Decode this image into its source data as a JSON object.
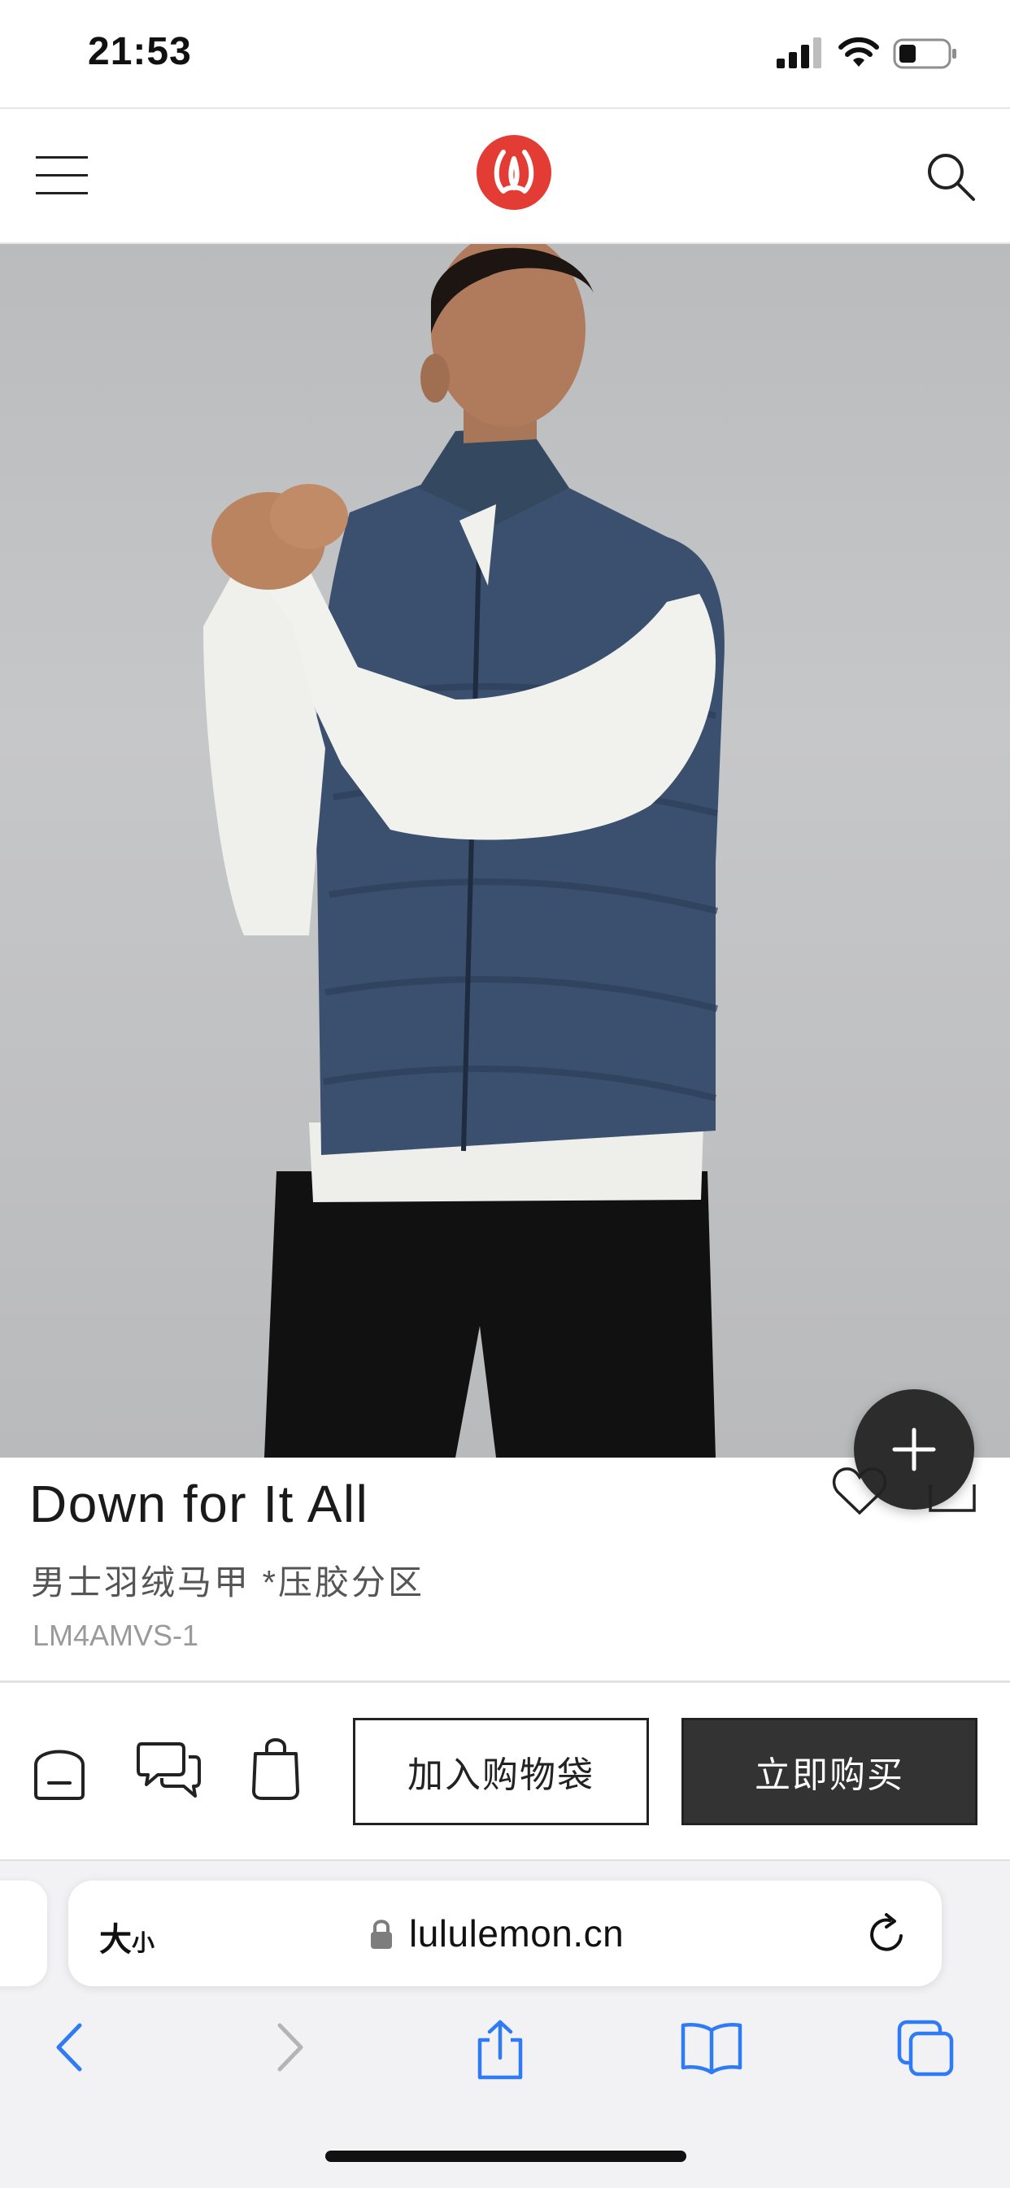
{
  "status_bar": {
    "time": "21:53",
    "icons": [
      "cellular-signal-icon",
      "wifi-icon",
      "battery-icon"
    ]
  },
  "header": {
    "menu_icon": "hamburger-menu-icon",
    "logo_icon": "lululemon-logo",
    "search_icon": "search-icon",
    "brand_color": "#e23c35"
  },
  "product": {
    "title": "Down for It All",
    "subtitle": "男士羽绒马甲 *压胶分区",
    "sku": "LM4AMVS-1",
    "image_description_icon": "product-photo",
    "wishlist_icon": "heart-icon",
    "share_icon": "share-icon",
    "add_icon": "plus-icon"
  },
  "action_bar": {
    "home_icon": "home-icon",
    "chat_icon": "chat-icon",
    "bag_icon": "shopping-bag-icon",
    "add_to_bag_label": "加入购物袋",
    "buy_now_label": "立即购买"
  },
  "browser": {
    "text_size_label": "大",
    "text_size_small": "小",
    "url": "lululemon.cn",
    "toolbar_icons": [
      "back-icon",
      "forward-icon",
      "share-icon",
      "bookmarks-icon",
      "tabs-icon"
    ],
    "accent_color": "#2f7bf6"
  }
}
